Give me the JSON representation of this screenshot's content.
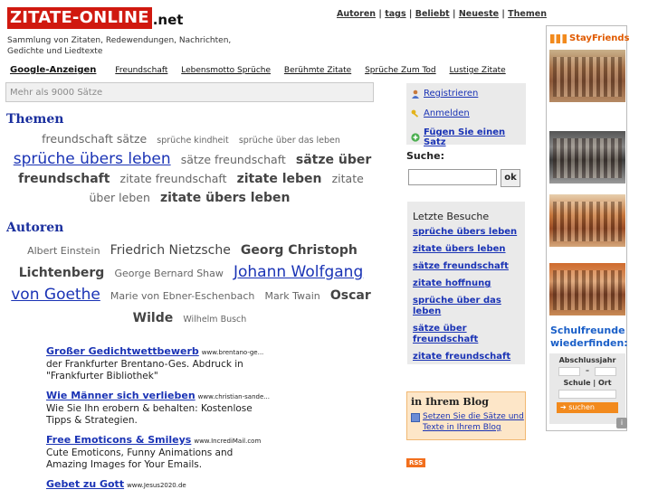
{
  "header": {
    "logo_main": "ZITATE-ONLINE",
    "logo_suffix": ".net",
    "tagline": "Sammlung von Zitaten, Redewendungen, Nachrichten, Gedichte und Liedtexte",
    "nav": [
      "Autoren",
      "tags",
      "Beliebt",
      "Neueste",
      "Themen"
    ],
    "nav_sep": "|"
  },
  "ads_row": {
    "label": "Google-Anzeigen",
    "links": [
      "Freundschaft",
      "Lebensmotto Sprüche",
      "Berühmte Zitate",
      "Sprüche Zum Tod",
      "Lustige Zitate"
    ]
  },
  "search_main": {
    "placeholder": "Mehr als 9000 Sätze"
  },
  "themen": {
    "title": "Themen",
    "tags": [
      {
        "text": "freundschaft sätze",
        "size": "s3"
      },
      {
        "text": "sprüche kindheit",
        "size": "s1"
      },
      {
        "text": "sprüche über das leben",
        "size": "s1"
      },
      {
        "text": "sprüche übers leben",
        "size": "big"
      },
      {
        "text": "sätze freundschaft",
        "size": "s3"
      },
      {
        "text": "sätze über freundschaft",
        "size": "s4"
      },
      {
        "text": "zitate freundschaft",
        "size": "s3"
      },
      {
        "text": "zitate leben",
        "size": "s4"
      },
      {
        "text": "zitate über leben",
        "size": "s3"
      },
      {
        "text": "zitate übers leben",
        "size": "s4"
      }
    ]
  },
  "autoren": {
    "title": "Autoren",
    "tags": [
      {
        "text": "Albert Einstein",
        "size": "s2"
      },
      {
        "text": "Friedrich Nietzsche",
        "size": "s4n"
      },
      {
        "text": "Georg Christoph Lichtenberg",
        "size": "s4"
      },
      {
        "text": "George Bernard Shaw",
        "size": "s2"
      },
      {
        "text": "Johann Wolfgang von Goethe",
        "size": "big"
      },
      {
        "text": "Marie von Ebner-Eschenbach",
        "size": "s2"
      },
      {
        "text": "Mark Twain",
        "size": "s2"
      },
      {
        "text": "Oscar Wilde",
        "size": "s4"
      },
      {
        "text": "Wilhelm Busch",
        "size": "s1"
      }
    ]
  },
  "text_ads": [
    {
      "title": "Großer Gedichtwettbewerb",
      "url": "www.brentano-ge...",
      "body": "der Frankfurter Brentano-Ges. Abdruck in \"Frankfurter Bibliothek\""
    },
    {
      "title": "Wie Männer sich verlieben",
      "url": "www.christian-sande...",
      "body": "Wie Sie Ihn erobern & behalten: Kostenlose Tipps & Strategien."
    },
    {
      "title": "Free Emoticons & Smileys",
      "url": "www.IncrediMail.com",
      "body": "Cute Emoticons, Funny Animations and Amazing Images for Your Emails."
    },
    {
      "title": "Gebet zu Gott",
      "url": "www.Jesus2020.de",
      "body": ""
    }
  ],
  "account": {
    "register": "Registrieren",
    "login": "Anmelden",
    "add": "Fügen Sie einen Satz"
  },
  "search_side": {
    "label": "Suche:",
    "button": "ok"
  },
  "recent": {
    "title": "Letzte Besuche",
    "items": [
      "sprüche übers leben",
      "zitate übers leben",
      "sätze freundschaft",
      "zitate hoffnung",
      "sprüche über das leben",
      "sätze über freundschaft",
      "zitate freundschaft"
    ]
  },
  "blog": {
    "title": "in Ihrem Blog",
    "text": "Setzen Sie die Sätze und Texte in Ihrem Blog"
  },
  "rss": "RSS",
  "banner": {
    "brand": "StayFriends",
    "headline": "Schulfreunde wiederfinden:",
    "field1": "Abschlussjahr",
    "dash": "–",
    "field2": "Schule | Ort",
    "button": "➔ suchen",
    "badge": "i"
  }
}
